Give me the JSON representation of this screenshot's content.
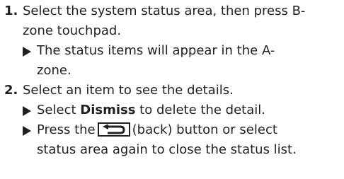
{
  "steps": [
    {
      "number": "1.",
      "text": "Select the system status area, then press B-zone touchpad."
    },
    {
      "number": "2.",
      "text": "Select an item to see the details."
    }
  ],
  "step1_sub": {
    "text": "The status items will appear in the A-zone."
  },
  "step2_sub1": {
    "before": "Select ",
    "bold": "Dismiss",
    "after": " to delete the detail."
  },
  "step2_sub2": {
    "before": "Press the",
    "icon": "back-button-icon",
    "after": "(back) button or select status area again to close the status list."
  },
  "colors": {
    "text": "#231f20",
    "background": "#ffffff"
  }
}
